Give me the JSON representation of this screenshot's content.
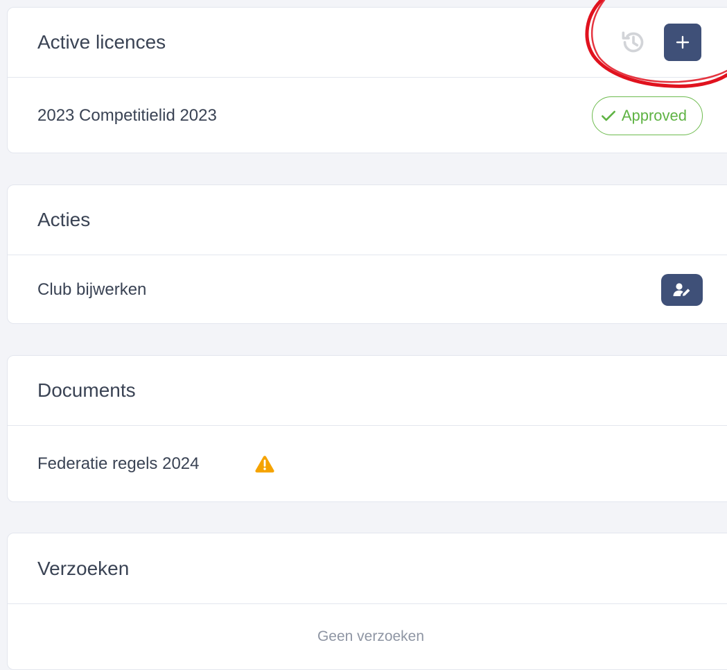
{
  "licences": {
    "title": "Active licences",
    "item": "2023 Competitielid 2023",
    "status": "Approved",
    "history_icon": "history-icon",
    "add_icon": "plus-icon"
  },
  "actions": {
    "title": "Acties",
    "item": "Club bijwerken",
    "edit_icon": "user-edit-icon"
  },
  "documents": {
    "title": "Documents",
    "item": "Federatie regels 2024",
    "warning_icon": "warning-icon"
  },
  "requests": {
    "title": "Verzoeken",
    "empty": "Geen verzoeken"
  },
  "colors": {
    "page_bg": "#f3f4f8",
    "button": "#3f5078",
    "approved": "#5fb344",
    "warning": "#f5a300",
    "annotation": "#e0121e"
  }
}
